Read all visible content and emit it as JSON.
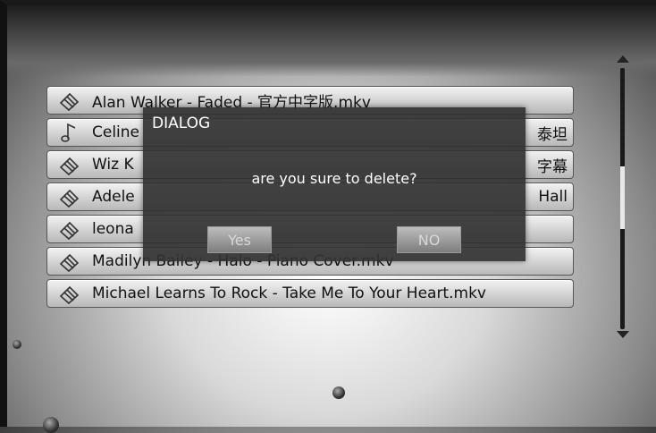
{
  "file_list": {
    "items": [
      {
        "label": "Alan Walker - Faded - 官方中字版.mkv",
        "icon": "video-file-icon"
      },
      {
        "label": "Celine",
        "icon": "music-note-icon",
        "trailing": "泰坦"
      },
      {
        "label": "Wiz K",
        "icon": "video-file-icon",
        "trailing": "字幕"
      },
      {
        "label": "Adele",
        "icon": "video-file-icon",
        "trailing": "Hall"
      },
      {
        "label": "leona",
        "icon": "video-file-icon",
        "trailing": ""
      },
      {
        "label": "Madilyn Bailey - Halo - Piano Cover.mkv",
        "icon": "video-file-icon"
      },
      {
        "label": "Michael Learns To Rock - Take Me To Your Heart.mkv",
        "icon": "video-file-icon"
      }
    ]
  },
  "dialog": {
    "title": "DIALOG",
    "message": "are you sure to delete?",
    "yes_label": "Yes",
    "no_label": "NO"
  },
  "scrollbar": {
    "up_icon": "chevron-up-icon",
    "down_icon": "chevron-down-icon"
  }
}
